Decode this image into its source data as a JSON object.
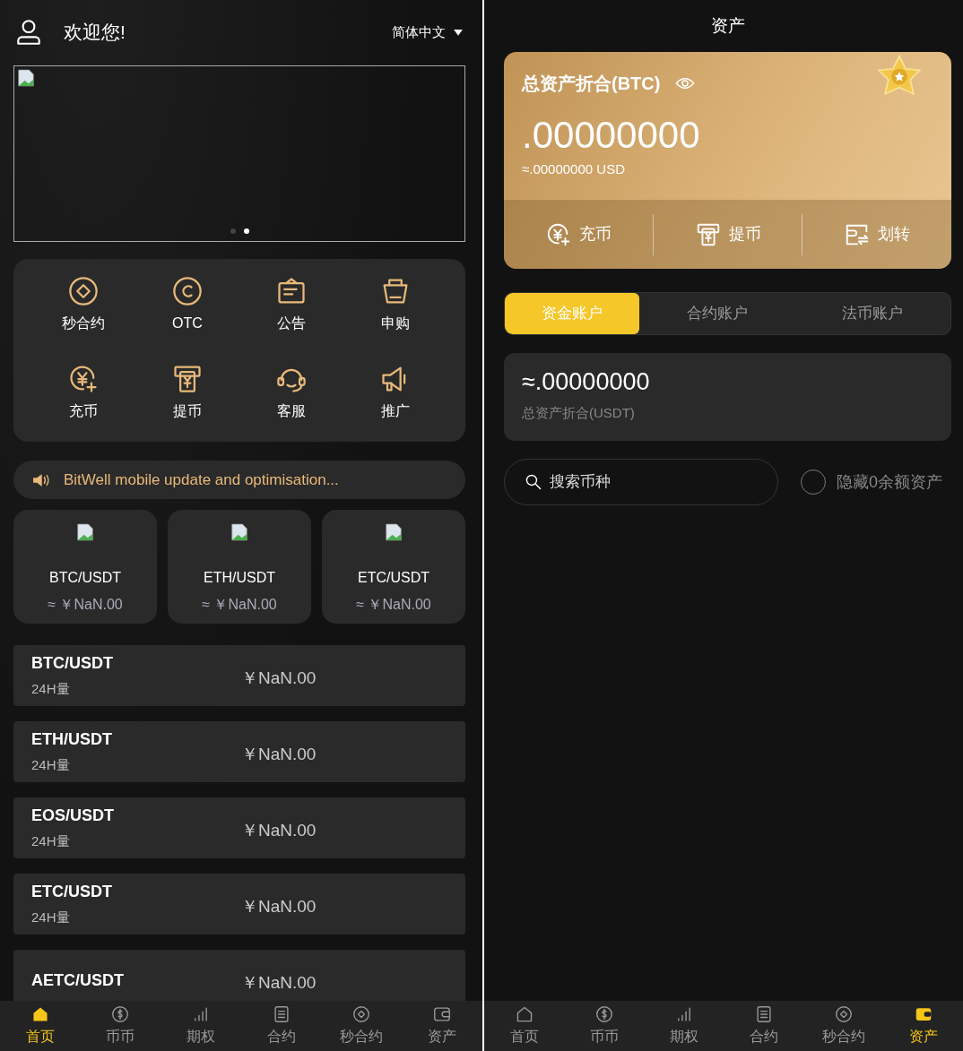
{
  "home": {
    "header": {
      "greeting": "欢迎您!",
      "language": "简体中文"
    },
    "banner": {
      "dots": [
        {
          "selected": false
        },
        {
          "selected": true
        }
      ]
    },
    "shortcuts": [
      {
        "label": "秒合约"
      },
      {
        "label": "OTC"
      },
      {
        "label": "公告"
      },
      {
        "label": "申购"
      },
      {
        "label": "充币"
      },
      {
        "label": "提币"
      },
      {
        "label": "客服"
      },
      {
        "label": "推广"
      }
    ],
    "notice": "BitWell mobile update and optimisation...",
    "tickers": [
      {
        "pair": "BTC/USDT",
        "price": "≈ ￥NaN.00"
      },
      {
        "pair": "ETH/USDT",
        "price": "≈ ￥NaN.00"
      },
      {
        "pair": "ETC/USDT",
        "price": "≈ ￥NaN.00"
      }
    ],
    "markets": [
      {
        "pair": "BTC/USDT",
        "volume_label": "24H量",
        "price": "￥NaN.00"
      },
      {
        "pair": "ETH/USDT",
        "volume_label": "24H量",
        "price": "￥NaN.00"
      },
      {
        "pair": "EOS/USDT",
        "volume_label": "24H量",
        "price": "￥NaN.00"
      },
      {
        "pair": "ETC/USDT",
        "volume_label": "24H量",
        "price": "￥NaN.00"
      },
      {
        "pair": "AETC/USDT",
        "price": "￥NaN.00"
      }
    ],
    "nav": [
      {
        "label": "首页",
        "selected": true
      },
      {
        "label": "币币",
        "selected": false
      },
      {
        "label": "期权",
        "selected": false
      },
      {
        "label": "合约",
        "selected": false
      },
      {
        "label": "秒合约",
        "selected": false
      },
      {
        "label": "资产",
        "selected": false
      }
    ]
  },
  "assets": {
    "title": "资产",
    "card": {
      "title": "总资产折合(BTC)",
      "balance": ".00000000",
      "usd": "≈.00000000 USD",
      "actions": [
        {
          "label": "充币"
        },
        {
          "label": "提币"
        },
        {
          "label": "划转"
        }
      ]
    },
    "tabs": [
      {
        "label": "资金账户",
        "selected": true
      },
      {
        "label": "合约账户",
        "selected": false
      },
      {
        "label": "法币账户",
        "selected": false
      }
    ],
    "summary": {
      "value": "≈.00000000",
      "label": "总资产折合(USDT)"
    },
    "search": {
      "placeholder": "搜索币种"
    },
    "hide_zero": {
      "label": "隐藏0余额资产",
      "checked": false
    },
    "nav": [
      {
        "label": "首页",
        "selected": false
      },
      {
        "label": "币币",
        "selected": false
      },
      {
        "label": "期权",
        "selected": false
      },
      {
        "label": "合约",
        "selected": false
      },
      {
        "label": "秒合约",
        "selected": false
      },
      {
        "label": "资产",
        "selected": true
      }
    ]
  }
}
